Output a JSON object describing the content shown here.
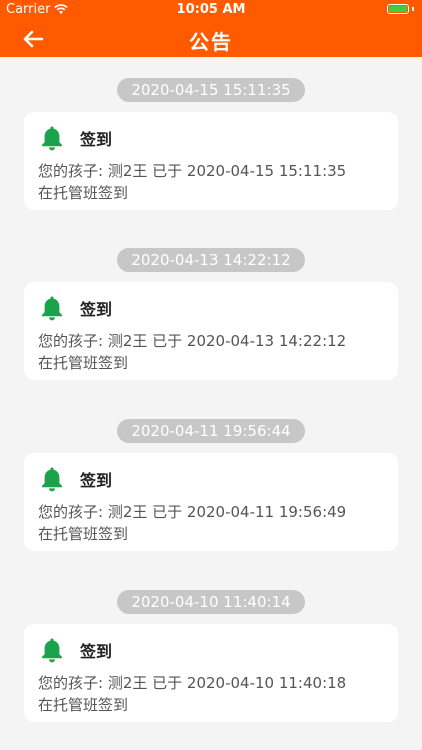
{
  "status_bar": {
    "carrier": "Carrier",
    "time": "10:05 AM",
    "battery_color": "#3bd13b"
  },
  "nav": {
    "title": "公告",
    "back_icon": "arrow-left-icon",
    "background": "#ff5a00"
  },
  "notices": [
    {
      "timestamp": "2020-04-15 15:11:35",
      "title": "签到",
      "line1": "您的孩子: 测2王 已于 2020-04-15 15:11:35",
      "line2": "在托管班签到"
    },
    {
      "timestamp": "2020-04-13 14:22:12",
      "title": "签到",
      "line1": "您的孩子: 测2王 已于 2020-04-13 14:22:12",
      "line2": "在托管班签到"
    },
    {
      "timestamp": "2020-04-11 19:56:44",
      "title": "签到",
      "line1": "您的孩子: 测2王 已于 2020-04-11 19:56:49",
      "line2": "在托管班签到"
    },
    {
      "timestamp": "2020-04-10 11:40:14",
      "title": "签到",
      "line1": "您的孩子: 测2王 已于 2020-04-10 11:40:18",
      "line2": "在托管班签到"
    }
  ],
  "colors": {
    "bell": "#1aa34a",
    "timestamp_pill": "#c7c7c7"
  }
}
